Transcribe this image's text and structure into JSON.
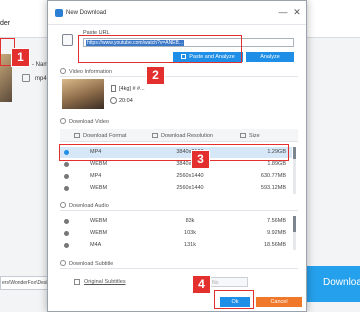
{
  "background_app": {
    "title": "der",
    "item_name": "- Name",
    "item_format": "mp4",
    "save_path": "ers\\WonderFox\\Deskt",
    "download_label": "Download"
  },
  "dialog": {
    "title": "New Download",
    "url_label": "Paste URL",
    "url_value": "https://www.youtube.com/watch?v=ANEB...",
    "paste_analyze_label": "Paste and Analyze",
    "analyze_label": "Analyze",
    "video_info_label": "Video Information",
    "video_title": "[4kg] # #...",
    "video_duration": "20:04",
    "download_video_label": "Download Video",
    "columns": {
      "format": "Download Format",
      "resolution": "Download Resolution",
      "size": "Size"
    },
    "video_rows": [
      {
        "format": "MP4",
        "resolution": "3840x2160",
        "size": "1.29GB",
        "selected": true
      },
      {
        "format": "WEBM",
        "resolution": "3840x2160",
        "size": "1.89GB",
        "selected": false
      },
      {
        "format": "MP4",
        "resolution": "2560x1440",
        "size": "630.77MB",
        "selected": false
      },
      {
        "format": "WEBM",
        "resolution": "2560x1440",
        "size": "593.12MB",
        "selected": false
      }
    ],
    "download_audio_label": "Download Audio",
    "audio_rows": [
      {
        "format": "WEBM",
        "bitrate": "83k",
        "size": "7.56MB"
      },
      {
        "format": "WEBM",
        "bitrate": "103k",
        "size": "9.92MB"
      },
      {
        "format": "M4A",
        "bitrate": "131k",
        "size": "18.56MB"
      }
    ],
    "download_subtitle_label": "Download Subtitle",
    "original_subtitles_label": "Original Subtitles",
    "subtitle_select_value": "No",
    "ok_label": "Ok",
    "cancel_label": "Cancel",
    "minimize_glyph": "—",
    "close_glyph": "✕"
  },
  "annotations": {
    "steps": [
      "1",
      "2",
      "3",
      "4"
    ],
    "color": "#e3302f"
  },
  "colors": {
    "accent": "#1f8ee6",
    "cancel": "#f0782a",
    "selected_row": "#d6e8f8"
  }
}
